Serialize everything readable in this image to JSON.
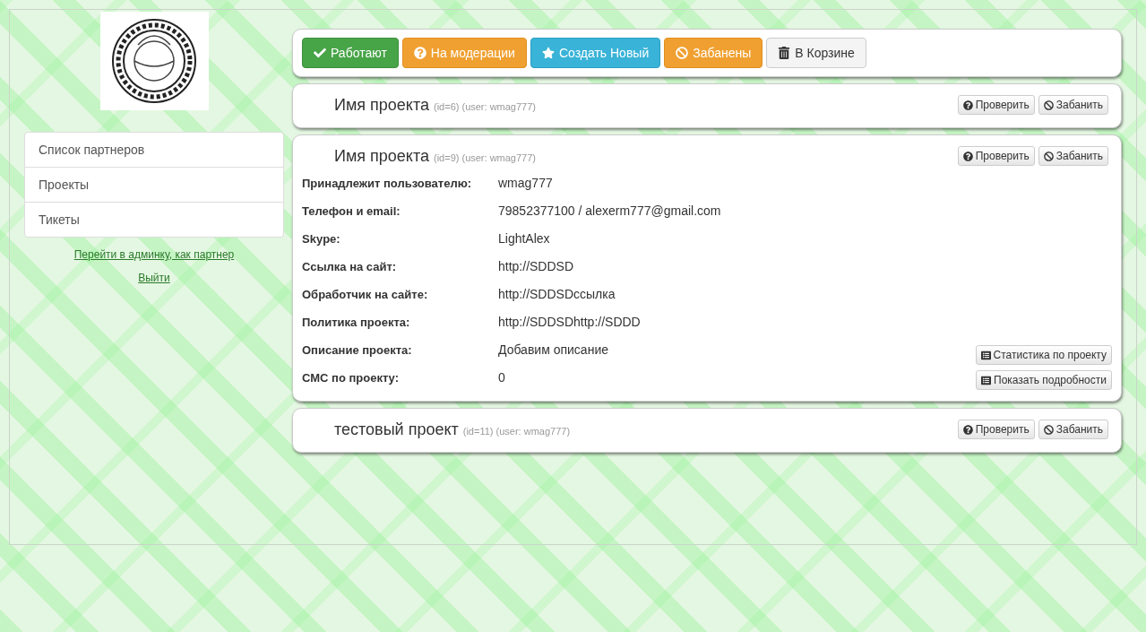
{
  "sidebar": {
    "items": [
      {
        "label": "Список партнеров"
      },
      {
        "label": "Проекты"
      },
      {
        "label": "Тикеты"
      }
    ],
    "links": [
      "Перейти в админку, как партнер",
      "Выйти"
    ]
  },
  "toolbar": [
    {
      "label": "Работают",
      "kind": "success"
    },
    {
      "label": "На модерации",
      "kind": "moderation"
    },
    {
      "label": "Создать Новый",
      "kind": "create"
    },
    {
      "label": "Забанены",
      "kind": "banned"
    },
    {
      "label": "В Корзине",
      "kind": "trash"
    }
  ],
  "projects": [
    {
      "name": "Имя проекта",
      "meta": "(id=6) (user: wmag777)",
      "actions": [
        "Проверить",
        "Забанить"
      ]
    },
    {
      "name": "Имя проекта",
      "meta": "(id=9) (user: wmag777)",
      "actions": [
        "Проверить",
        "Забанить"
      ],
      "details": [
        {
          "label": "Принадлежит пользователю:",
          "value": "wmag777"
        },
        {
          "label": "Телефон и email:",
          "value": "79852377100 / alexerm777@gmail.com"
        },
        {
          "label": "Skype:",
          "value": "LightAlex"
        },
        {
          "label": "Ссылка на сайт:",
          "value": "http://SDDSD"
        },
        {
          "label": "Обработчик на сайте:",
          "value": "http://SDDSDссылка"
        },
        {
          "label": "Политика проекта:",
          "value": "http://SDDSDhttp://SDDD"
        },
        {
          "label": "Описание проекта:",
          "value": "Добавим описание"
        },
        {
          "label": "СМС по проекту:",
          "value": "0"
        }
      ],
      "extra_actions": [
        "Статистика по проекту",
        "Показать подробности"
      ]
    },
    {
      "name": "тестовый проект",
      "meta": "(id=11) (user: wmag777)",
      "actions": [
        "Проверить",
        "Забанить"
      ]
    }
  ]
}
